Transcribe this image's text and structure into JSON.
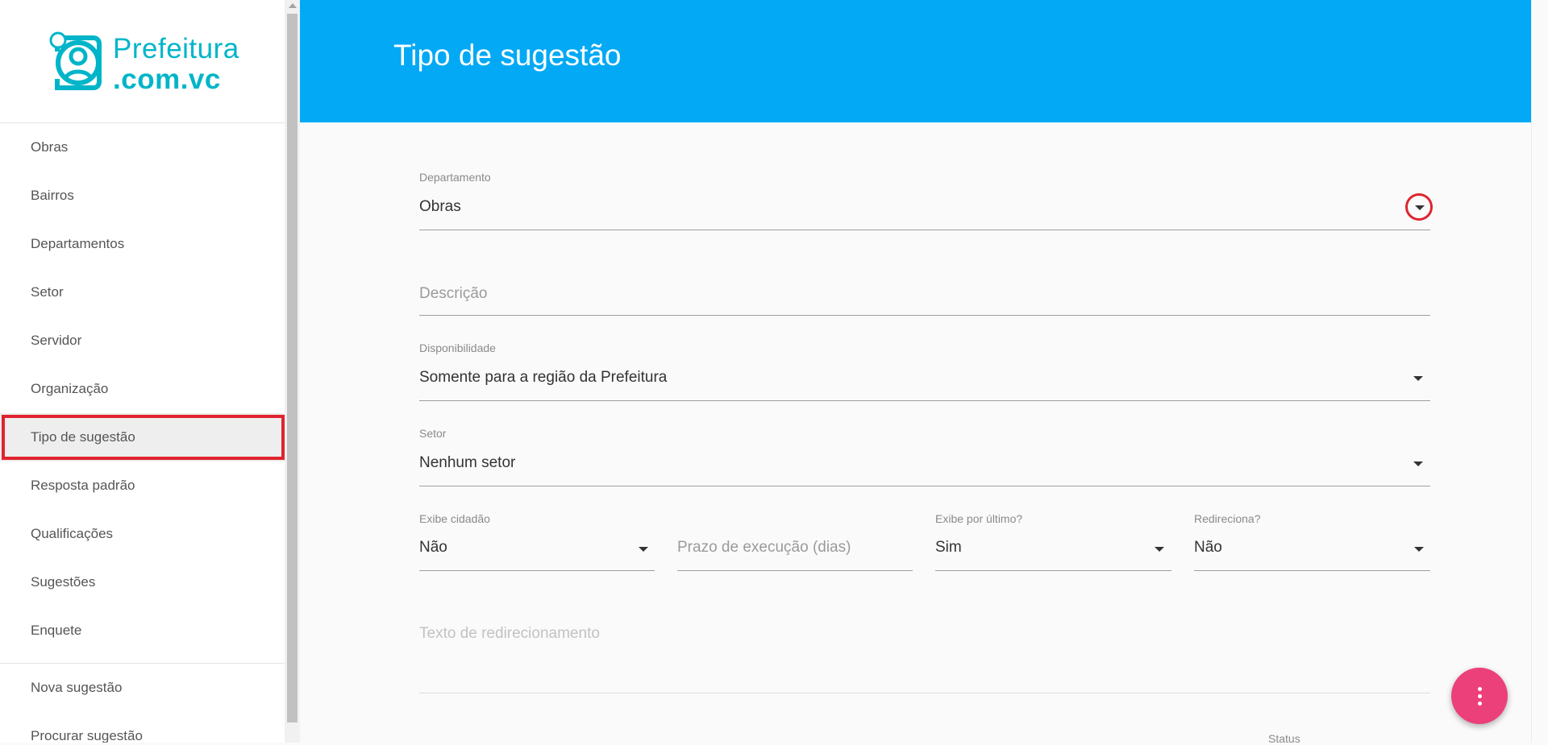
{
  "brand": {
    "line1": "Prefeitura",
    "line2": ".com.vc",
    "color": "#00b5c9"
  },
  "sidebar": {
    "items": [
      {
        "label": "Obras"
      },
      {
        "label": "Bairros"
      },
      {
        "label": "Departamentos"
      },
      {
        "label": "Setor"
      },
      {
        "label": "Servidor"
      },
      {
        "label": "Organização"
      },
      {
        "label": "Tipo de sugestão",
        "active": true
      },
      {
        "label": "Resposta padrão"
      },
      {
        "label": "Qualificações"
      },
      {
        "label": "Sugestões"
      },
      {
        "label": "Enquete"
      }
    ],
    "secondary_items": [
      {
        "label": "Nova sugestão"
      },
      {
        "label": "Procurar sugestão"
      }
    ]
  },
  "header": {
    "title": "Tipo de sugestão",
    "color": "#03a9f4"
  },
  "form": {
    "departamento": {
      "label": "Departamento",
      "value": "Obras"
    },
    "descricao": {
      "placeholder": "Descrição"
    },
    "disponibilidade": {
      "label": "Disponibilidade",
      "value": "Somente para a região da Prefeitura"
    },
    "setor": {
      "label": "Setor",
      "value": "Nenhum setor"
    },
    "exibe_cidadao": {
      "label": "Exibe cidadão",
      "value": "Não"
    },
    "prazo": {
      "placeholder": "Prazo de execução (dias)"
    },
    "exibe_ultimo": {
      "label": "Exibe por último?",
      "value": "Sim"
    },
    "redireciona": {
      "label": "Redireciona?",
      "value": "Não"
    },
    "texto_redirecionamento": {
      "placeholder": "Texto de redirecionamento"
    },
    "status": {
      "label": "Status"
    }
  },
  "fab": {
    "icon": "more-vert-icon",
    "color": "#ec407a"
  },
  "highlight_color": "#e0242f"
}
